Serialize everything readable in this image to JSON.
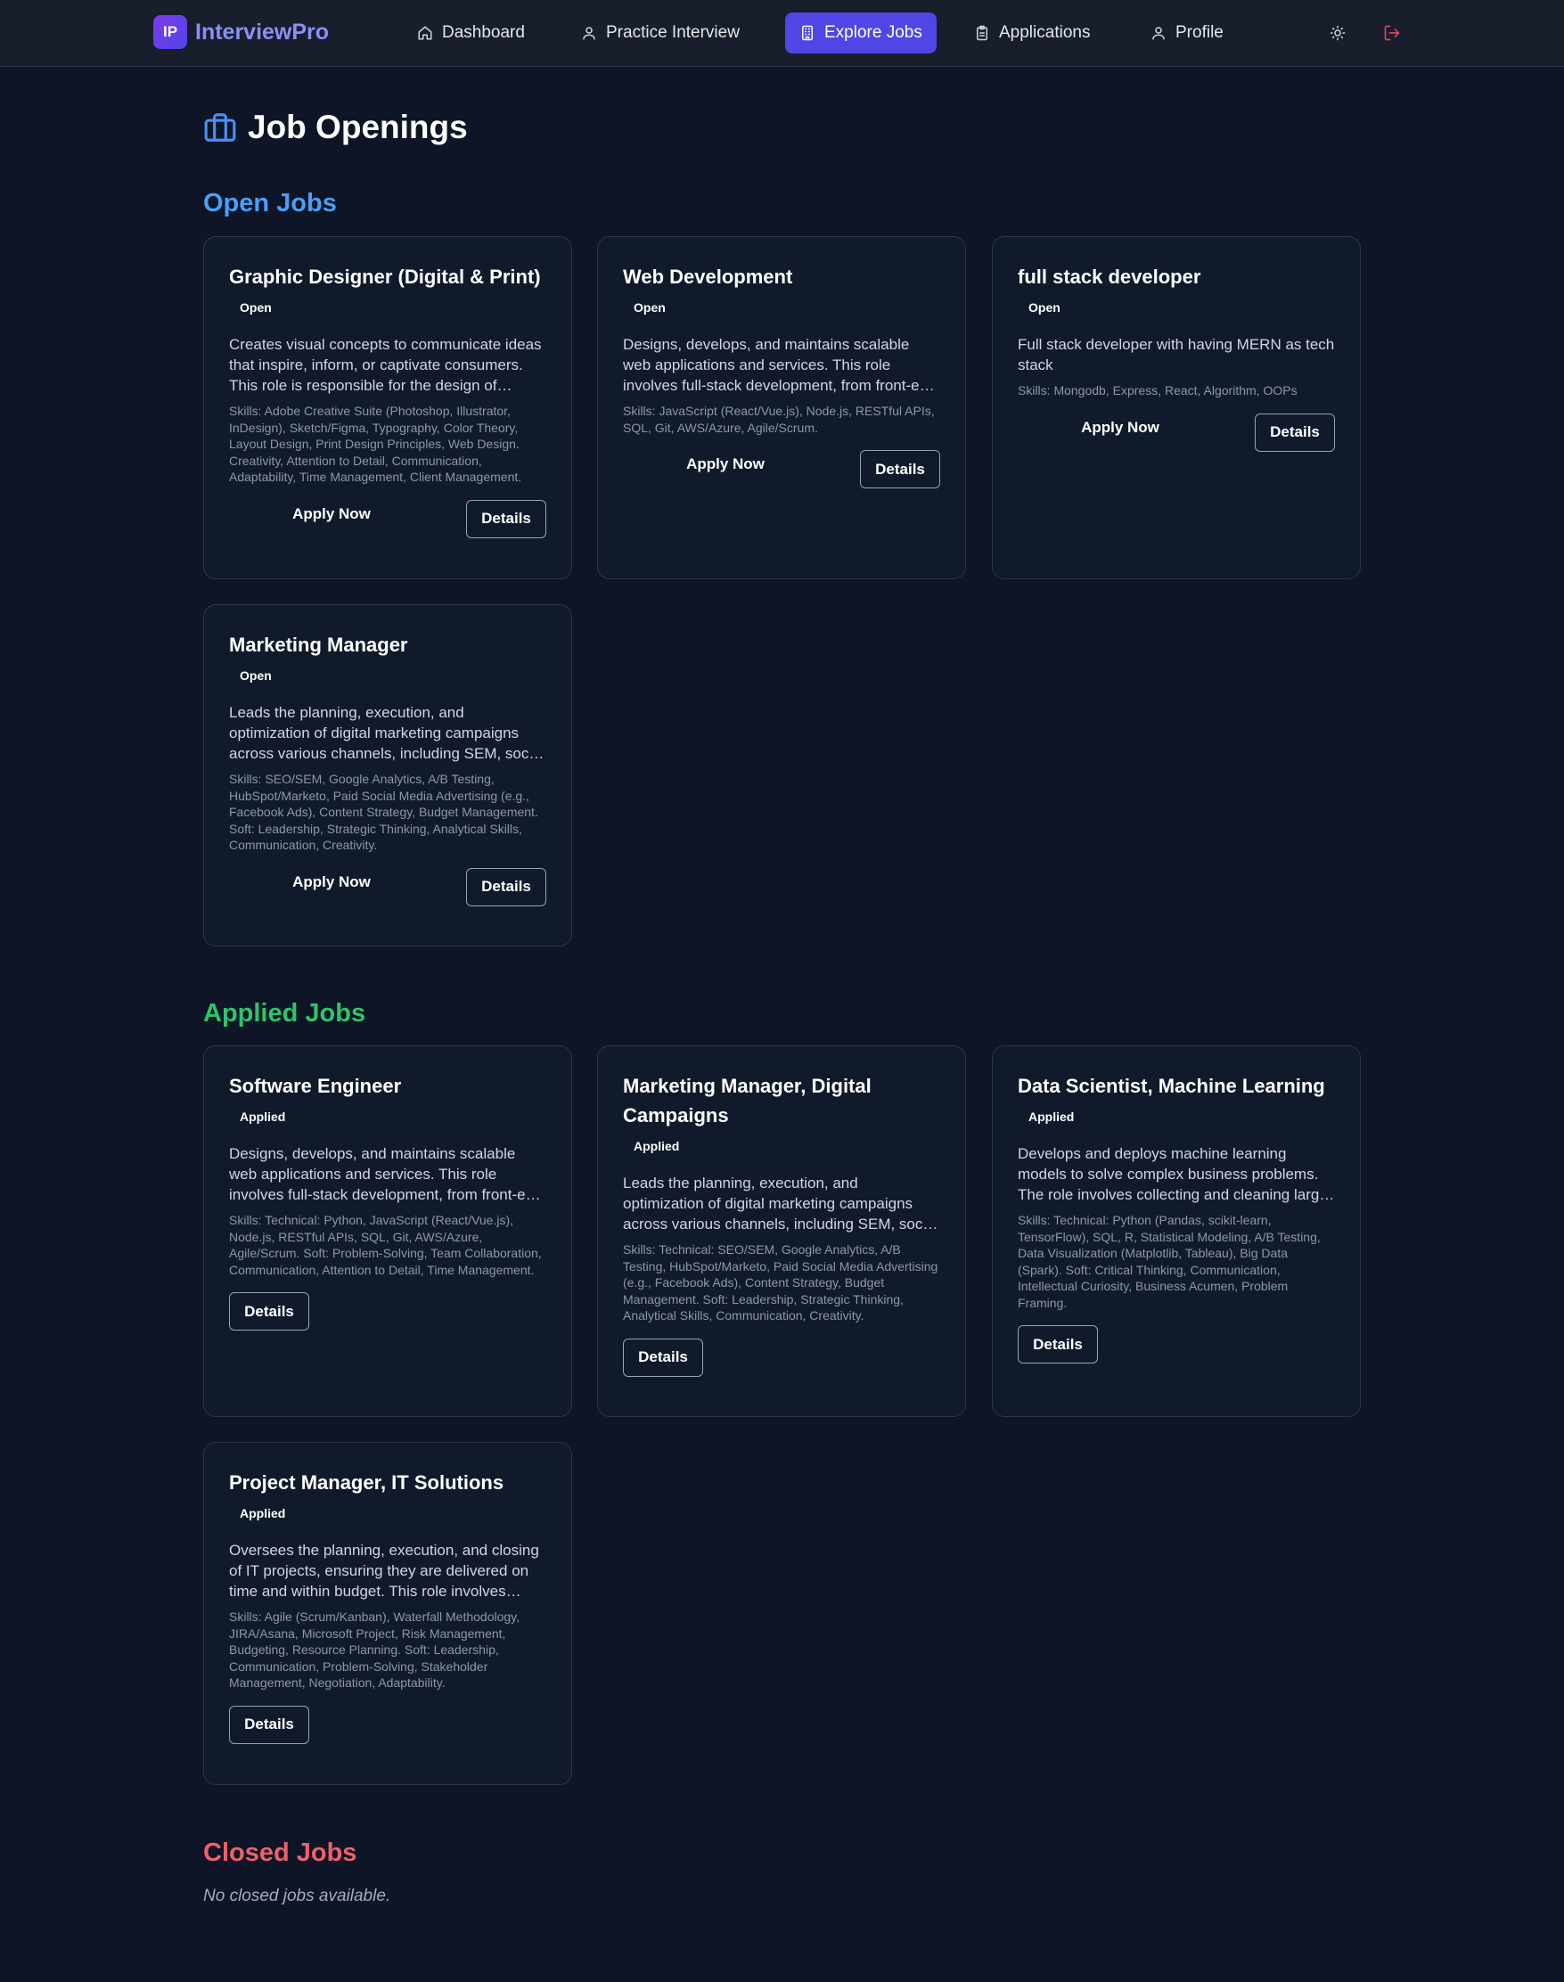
{
  "brand": {
    "logo_text": "IP",
    "name": "InterviewPro"
  },
  "nav": {
    "items": [
      {
        "label": "Dashboard",
        "icon": "home-icon"
      },
      {
        "label": "Practice Interview",
        "icon": "user-icon"
      },
      {
        "label": "Explore Jobs",
        "icon": "building-icon",
        "active": true
      },
      {
        "label": "Applications",
        "icon": "clipboard-icon"
      },
      {
        "label": "Profile",
        "icon": "user-icon"
      }
    ],
    "theme_icon": "sun-icon",
    "logout_icon": "logout-icon"
  },
  "page": {
    "title": "Job Openings",
    "title_icon": "briefcase-icon"
  },
  "sections": {
    "open": {
      "title": "Open Jobs",
      "jobs": [
        {
          "title": "Graphic Designer (Digital & Print)",
          "status": "Open",
          "description": "Creates visual concepts to communicate ideas that inspire, inform, or captivate consumers. This role is responsible for the design of logos,...",
          "skills": "Skills: Adobe Creative Suite (Photoshop, Illustrator, InDesign), Sketch/Figma, Typography, Color Theory, Layout Design, Print Design Principles, Web Design. Creativity, Attention to Detail, Communication, Adaptability, Time Management, Client Management.",
          "apply_label": "Apply Now",
          "details_label": "Details"
        },
        {
          "title": "Web Development",
          "status": "Open",
          "description": "Designs, develops, and maintains scalable web applications and services. This role involves full-stack development, from front-end user...",
          "skills": "Skills: JavaScript (React/Vue.js), Node.js, RESTful APIs, SQL, Git, AWS/Azure, Agile/Scrum.",
          "apply_label": "Apply Now",
          "details_label": "Details"
        },
        {
          "title": "full stack developer",
          "status": "Open",
          "description": "Full stack developer with having MERN as tech stack",
          "skills": "Skills: Mongodb, Express, React, Algorithm, OOPs",
          "apply_label": "Apply Now",
          "details_label": "Details"
        },
        {
          "title": "Marketing Manager",
          "status": "Open",
          "description": "Leads the planning, execution, and optimization of digital marketing campaigns across various channels, including SEM, social media, and emai...",
          "skills": "Skills: SEO/SEM, Google Analytics, A/B Testing, HubSpot/Marketo, Paid Social Media Advertising (e.g., Facebook Ads), Content Strategy, Budget Management. Soft: Leadership, Strategic Thinking, Analytical Skills, Communication, Creativity.",
          "apply_label": "Apply Now",
          "details_label": "Details"
        }
      ]
    },
    "applied": {
      "title": "Applied Jobs",
      "jobs": [
        {
          "title": "Software Engineer",
          "status": "Applied",
          "description": "Designs, develops, and maintains scalable web applications and services. This role involves full-stack development, from front-end user...",
          "skills": "Skills: Technical: Python, JavaScript (React/Vue.js), Node.js, RESTful APIs, SQL, Git, AWS/Azure, Agile/Scrum. Soft: Problem-Solving, Team Collaboration, Communication, Attention to Detail, Time Management.",
          "details_label": "Details"
        },
        {
          "title": "Marketing Manager, Digital Campaigns",
          "status": "Applied",
          "description": "Leads the planning, execution, and optimization of digital marketing campaigns across various channels, including SEM, social media, and emai...",
          "skills": "Skills: Technical: SEO/SEM, Google Analytics, A/B Testing, HubSpot/Marketo, Paid Social Media Advertising (e.g., Facebook Ads), Content Strategy, Budget Management. Soft: Leadership, Strategic Thinking, Analytical Skills, Communication, Creativity.",
          "details_label": "Details"
        },
        {
          "title": "Data Scientist, Machine Learning",
          "status": "Applied",
          "description": "Develops and deploys machine learning models to solve complex business problems. The role involves collecting and cleaning large datasets,...",
          "skills": "Skills: Technical: Python (Pandas, scikit-learn, TensorFlow), SQL, R, Statistical Modeling, A/B Testing, Data Visualization (Matplotlib, Tableau), Big Data (Spark). Soft: Critical Thinking, Communication, Intellectual Curiosity, Business Acumen, Problem Framing.",
          "details_label": "Details"
        },
        {
          "title": "Project Manager, IT Solutions",
          "status": "Applied",
          "description": "Oversees the planning, execution, and closing of IT projects, ensuring they are delivered on time and within budget. This role involves defining...",
          "skills": "Skills: Agile (Scrum/Kanban), Waterfall Methodology, JIRA/Asana, Microsoft Project, Risk Management, Budgeting, Resource Planning. Soft: Leadership, Communication, Problem-Solving, Stakeholder Management, Negotiation, Adaptability.",
          "details_label": "Details"
        }
      ]
    },
    "closed": {
      "title": "Closed Jobs",
      "empty_text": "No closed jobs available."
    }
  },
  "colors": {
    "background": "#0d1526",
    "nav_active": "#4f46e5",
    "open_title": "#4a9ff5",
    "applied_title": "#2fc36a",
    "closed_title": "#f0606a",
    "logout": "#e0445a"
  }
}
